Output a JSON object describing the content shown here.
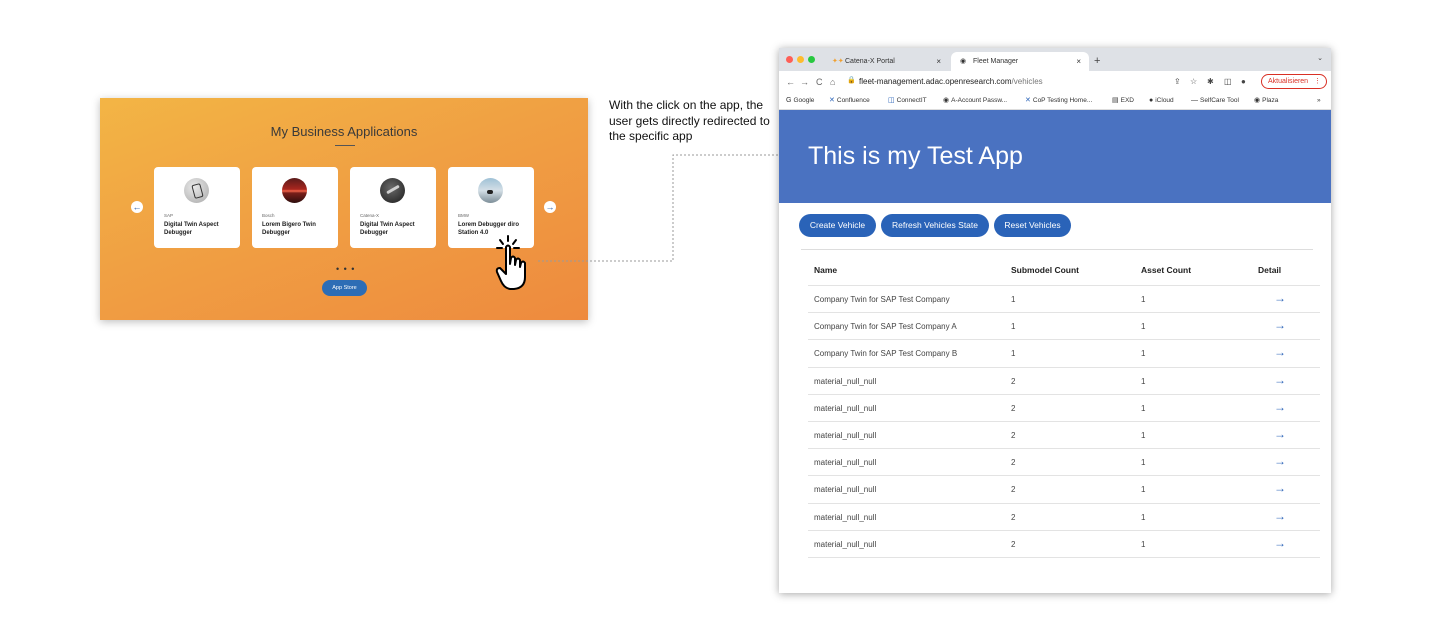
{
  "apps_panel": {
    "title": "My Business Applications",
    "prev_arrow": "←",
    "next_arrow": "→",
    "cards": [
      {
        "vendor": "SAP",
        "name": "Digital Twin Aspect Debugger"
      },
      {
        "vendor": "Bosch",
        "name": "Lorem  Bigero Twin Debugger"
      },
      {
        "vendor": "Catena-X",
        "name": "Digital Twin Aspect Debugger"
      },
      {
        "vendor": "BMW",
        "name": "Lorem Debugger diro Station 4.0"
      }
    ],
    "dots": "• • •",
    "app_store_label": "App Store"
  },
  "annotation": {
    "text": "With the click on the app, the user gets directly redirected to the specific app"
  },
  "browser": {
    "tabs": [
      {
        "title": "Catena-X Portal",
        "icon": "catena-x-logo-icon"
      },
      {
        "title": "Fleet Manager",
        "icon": "globe-icon"
      }
    ],
    "tab_close": "×",
    "new_tab": "+",
    "tab_menu": "⌄",
    "nav": {
      "back": "←",
      "forward": "→",
      "reload": "C",
      "home": "⌂"
    },
    "url_host": "fleet-management.adac.openresearch.com",
    "url_path": "/vehicles",
    "update_label": "Aktualisieren",
    "update_menu": "⋮",
    "bookmarks": [
      {
        "label": "Google",
        "icon": "G"
      },
      {
        "label": "Confluence",
        "icon": "✕"
      },
      {
        "label": "ConnectIT",
        "icon": "◫"
      },
      {
        "label": "A-Account Passw...",
        "icon": "◉"
      },
      {
        "label": "CoP Testing Home...",
        "icon": "✕"
      },
      {
        "label": "EXD",
        "icon": "▤"
      },
      {
        "label": "iCloud",
        "icon": ""
      },
      {
        "label": "SelfCare Tool",
        "icon": "—"
      },
      {
        "label": "Plaza",
        "icon": "◉"
      }
    ],
    "bookmarks_more": "»"
  },
  "test_app": {
    "heading": "This is my Test App",
    "buttons": {
      "create": "Create Vehicle",
      "refresh": "Refresh Vehicles State",
      "reset": "Reset Vehicles"
    },
    "table": {
      "headers": {
        "name": "Name",
        "submodel": "Submodel Count",
        "asset": "Asset Count",
        "detail": "Detail"
      },
      "rows": [
        {
          "name": "Company Twin for SAP Test Company",
          "submodel": "1",
          "asset": "1"
        },
        {
          "name": "Company Twin for SAP Test Company A",
          "submodel": "1",
          "asset": "1"
        },
        {
          "name": "Company Twin for SAP Test Company B",
          "submodel": "1",
          "asset": "1"
        },
        {
          "name": "material_null_null",
          "submodel": "2",
          "asset": "1"
        },
        {
          "name": "material_null_null",
          "submodel": "2",
          "asset": "1"
        },
        {
          "name": "material_null_null",
          "submodel": "2",
          "asset": "1"
        },
        {
          "name": "material_null_null",
          "submodel": "2",
          "asset": "1"
        },
        {
          "name": "material_null_null",
          "submodel": "2",
          "asset": "1"
        },
        {
          "name": "material_null_null",
          "submodel": "2",
          "asset": "1"
        },
        {
          "name": "material_null_null",
          "submodel": "2",
          "asset": "1"
        }
      ],
      "detail_glyph": "→"
    }
  },
  "colors": {
    "panel_orange": "#f0a043",
    "header_blue": "#4a72c1",
    "button_blue": "#2a63b8",
    "update_red": "#d93025"
  }
}
